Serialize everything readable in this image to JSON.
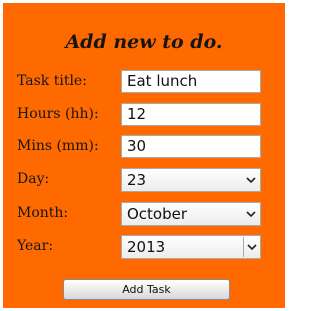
{
  "form": {
    "title": "Add new to do.",
    "fields": {
      "task_title": {
        "label": "Task title:",
        "value": "Eat lunch"
      },
      "hours": {
        "label": "Hours (hh):",
        "value": "12"
      },
      "mins": {
        "label": "Mins (mm):",
        "value": "30"
      },
      "day": {
        "label": "Day:",
        "value": "23"
      },
      "month": {
        "label": "Month:",
        "value": "October"
      },
      "year": {
        "label": "Year:",
        "value": "2013"
      }
    },
    "submit_label": "Add Task"
  },
  "colors": {
    "background": "#ff6a00",
    "text": "#151515",
    "field_border": "#a9a9a9"
  },
  "icons": {
    "dropdown": "chevron-down-icon"
  }
}
